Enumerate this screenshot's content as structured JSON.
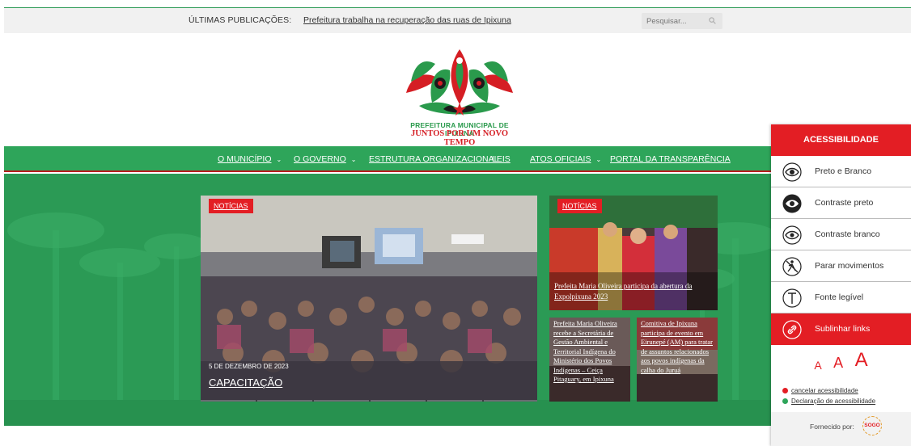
{
  "topbar": {
    "label": "ÚLTIMAS PUBLICAÇÕES:",
    "latest": "Prefeitura trabalha na recuperação das ruas de Ipixuna",
    "search_placeholder": "Pesquisar..."
  },
  "logo": {
    "line1": "PREFEITURA MUNICIPAL DE IPIXUNA",
    "line2": "JUNTOS POR UM NOVO TEMPO"
  },
  "nav": [
    {
      "label": "O MUNICÍPIO",
      "has_dropdown": true
    },
    {
      "label": "O GOVERNO",
      "has_dropdown": true
    },
    {
      "label": "ESTRUTURA ORGANIZACIONAL",
      "has_dropdown": false
    },
    {
      "label": "LEIS",
      "has_dropdown": false
    },
    {
      "label": "ATOS OFICIAIS",
      "has_dropdown": true
    },
    {
      "label": "PORTAL DA TRANSPARÊNCIA",
      "has_dropdown": false
    }
  ],
  "posts": {
    "main": {
      "tag": "NOTÍCIAS",
      "date": "5 DE DEZEMBRO DE 2023",
      "title": "CAPACITAÇÃO"
    },
    "side_top": {
      "tag": "NOTÍCIAS",
      "title": "Prefeita Maria Oliveira participa da abertura da Expolpixuna 2023"
    },
    "side_left": {
      "title": "Prefeita Maria Oliveira recebe a Secretária de Gestão Ambiental e Territorial Indígena do Ministério dos Povos Indígenas – Ceiça Pitaguary, em Ipixuna"
    },
    "side_right": {
      "title": "Comitiva de Ipixuna participa de evento em Eirunepé (AM) para tratar de assuntos relacionados aos povos indígenas da calha do Juruá"
    }
  },
  "accessibility": {
    "title": "ACESSIBILIDADE",
    "items": [
      {
        "label": "Preto e Branco",
        "icon": "eye-outline-icon"
      },
      {
        "label": "Contraste preto",
        "icon": "eye-dark-icon"
      },
      {
        "label": "Contraste branco",
        "icon": "eye-light-icon"
      },
      {
        "label": "Parar movimentos",
        "icon": "stop-motion-icon"
      },
      {
        "label": "Fonte legível",
        "icon": "font-t-icon"
      },
      {
        "label": "Sublinhar links",
        "icon": "link-icon",
        "active": true
      }
    ],
    "font_sizes": [
      "A",
      "A",
      "A"
    ],
    "cancel_link": "cancelar acessibilidade",
    "declaration_link": "Declaração de acessibilidade",
    "provided_by": "Fornecido por:",
    "provider_logo": "SOGO"
  },
  "colors": {
    "brand_green": "#2ea55a",
    "brand_red": "#e31e24"
  }
}
